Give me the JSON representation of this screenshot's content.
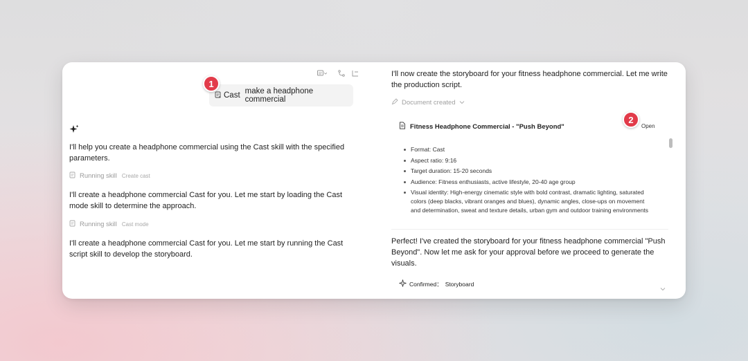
{
  "user_message": {
    "skill_label": "Cast",
    "text": "make a headphone commercial"
  },
  "badges": [
    "1",
    "2"
  ],
  "left": {
    "intro": "I'll help you create a headphone commercial using the Cast skill with the specified parameters.",
    "run1": {
      "label": "Running skill",
      "sub": "Create cast"
    },
    "para2": "I'll create a headphone commercial Cast for you. Let me start by loading the Cast mode skill to determine the approach.",
    "run2": {
      "label": "Running skill",
      "sub": "Cast mode"
    },
    "para3": "I'll create a headphone commercial Cast for you. Let me start by running the Cast script skill to develop the storyboard."
  },
  "right": {
    "intro": "I'll now create the storyboard for your fitness headphone commercial. Let me write the production script.",
    "doc_created": "Document created",
    "doc_title": "Fitness Headphone Commercial - \"Push Beyond\"",
    "open_label": "Open",
    "doc_items": [
      "Format: Cast",
      "Aspect ratio: 9:16",
      "Target duration: 15-20 seconds",
      "Audience: Fitness enthusiasts, active lifestyle, 20-40 age group",
      "Visual identity: High-energy cinematic style with bold contrast, dramatic lighting, saturated colors (deep blacks, vibrant oranges and blues), dynamic angles, close-ups on movement and determination, sweat and texture details, urban gym and outdoor training environments"
    ],
    "summary": "Perfect! I've created the storyboard for your fitness headphone commercial \"Push Beyond\". Now let me ask for your approval before we proceed to generate the visuals.",
    "confirmed_label": "Confirmed：",
    "confirmed_value": "Storyboard"
  },
  "colors": {
    "badge": "#e23b4a",
    "bubble": "#f3f3f3"
  },
  "icons": [
    "note-icon",
    "branch-icon",
    "collapse-icon",
    "skill-icon",
    "sparkle-icon",
    "pen-icon",
    "chevron-down-icon",
    "document-icon"
  ]
}
